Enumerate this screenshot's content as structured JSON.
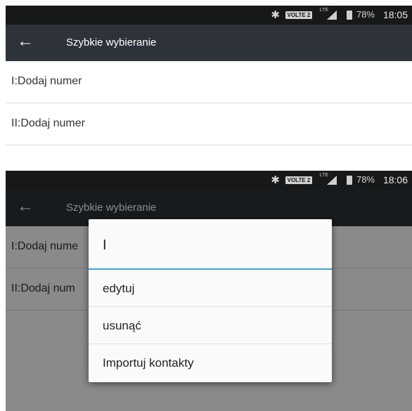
{
  "screens": [
    {
      "status": {
        "volte": "VOLTE 2",
        "network": "LTE",
        "battery": "78%",
        "time": "18:05"
      },
      "appbar": {
        "back_icon": "arrow-left-icon",
        "back_glyph": "←",
        "title": "Szybkie wybieranie"
      },
      "rows": [
        "I:Dodaj numer",
        "II:Dodaj numer"
      ]
    },
    {
      "status": {
        "volte": "VOLTE 2",
        "network": "LTE",
        "battery": "78%",
        "time": "18:06"
      },
      "appbar": {
        "back_icon": "arrow-left-icon",
        "back_glyph": "←",
        "title": "Szybkie wybieranie"
      },
      "rows": [
        "I:Dodaj nume",
        "II:Dodaj num"
      ],
      "dialog": {
        "title": "I",
        "accent_color": "#3aa4d8",
        "items": [
          "edytuj",
          "usunąć",
          "Importuj kontakty"
        ]
      }
    }
  ]
}
